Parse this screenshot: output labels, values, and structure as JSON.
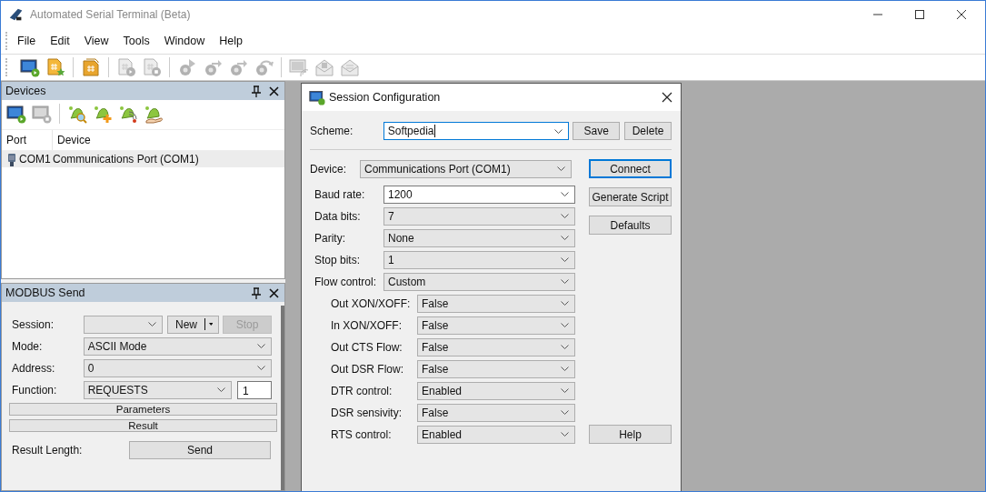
{
  "window": {
    "title": "Automated Serial Terminal (Beta)"
  },
  "menu": [
    "File",
    "Edit",
    "View",
    "Tools",
    "Window",
    "Help"
  ],
  "toolbar": [
    [
      {
        "kind": "monitor-play",
        "disabled": false
      },
      {
        "kind": "script-new",
        "disabled": false
      }
    ],
    [
      {
        "kind": "script",
        "disabled": false
      }
    ],
    [
      {
        "kind": "script-play",
        "disabled": true
      },
      {
        "kind": "script-stop",
        "disabled": true
      }
    ],
    [
      {
        "kind": "gear-play",
        "disabled": true
      },
      {
        "kind": "gear-arrow",
        "disabled": true
      },
      {
        "kind": "gear-arrow",
        "disabled": true
      },
      {
        "kind": "gear-undo",
        "disabled": true
      }
    ],
    [
      {
        "kind": "terminal",
        "disabled": true
      },
      {
        "kind": "mail-open",
        "disabled": true
      },
      {
        "kind": "mail",
        "disabled": true
      }
    ]
  ],
  "devices": {
    "title": "Devices",
    "toolbar": [
      [
        {
          "kind": "monitor-play",
          "disabled": false
        },
        {
          "kind": "monitor-stop",
          "disabled": true
        }
      ],
      [
        {
          "kind": "bell-search",
          "disabled": false
        },
        {
          "kind": "bell-plus",
          "disabled": false
        },
        {
          "kind": "bell-signal",
          "disabled": false
        },
        {
          "kind": "bell-hand",
          "disabled": false
        }
      ]
    ],
    "columns": [
      "Port",
      "Device"
    ],
    "rows": [
      {
        "port": "COM1",
        "device": "Communications Port (COM1)",
        "selected": true
      }
    ]
  },
  "modbus": {
    "title": "MODBUS Send",
    "session_label": "Session:",
    "new_button": "New",
    "stop_button": {
      "label": "Stop",
      "disabled": true
    },
    "rows": [
      {
        "label": "Mode:",
        "value": "ASCII Mode"
      },
      {
        "label": "Address:",
        "value": "0"
      },
      {
        "label": "Function:",
        "value": "REQUESTS",
        "count": "1"
      }
    ],
    "groups": [
      "Parameters",
      "Result"
    ],
    "result_label": "Result Length:",
    "send_button": "Send"
  },
  "dialog": {
    "title": "Session Configuration",
    "scheme": {
      "label": "Scheme:",
      "value": "Softpedia",
      "focused": true
    },
    "scheme_buttons": [
      "Save",
      "Delete"
    ],
    "device": {
      "label": "Device:",
      "value": "Communications Port (COM1)"
    },
    "settings": [
      {
        "label": "Baud rate:",
        "value": "1200",
        "editable": true
      },
      {
        "label": "Data bits:",
        "value": "7",
        "editable": false
      },
      {
        "label": "Parity:",
        "value": "None",
        "editable": false
      },
      {
        "label": "Stop bits:",
        "value": "1",
        "editable": false
      },
      {
        "label": "Flow control:",
        "value": "Custom",
        "editable": false,
        "children": [
          {
            "label": "Out XON/XOFF:",
            "value": "False",
            "editable": false
          },
          {
            "label": "In XON/XOFF:",
            "value": "False",
            "editable": false
          },
          {
            "label": "Out CTS Flow:",
            "value": "False",
            "editable": false
          },
          {
            "label": "Out DSR Flow:",
            "value": "False",
            "editable": false
          },
          {
            "label": "DTR control:",
            "value": "Enabled",
            "editable": false
          },
          {
            "label": "DSR sensivity:",
            "value": "False",
            "editable": false
          },
          {
            "label": "RTS control:",
            "value": "Enabled",
            "editable": false
          }
        ]
      }
    ],
    "side_buttons": [
      {
        "label": "Connect",
        "default": true
      },
      {
        "label": "Generate Script",
        "default": false
      },
      {
        "label": "Defaults",
        "default": false
      }
    ],
    "help_button": "Help"
  }
}
